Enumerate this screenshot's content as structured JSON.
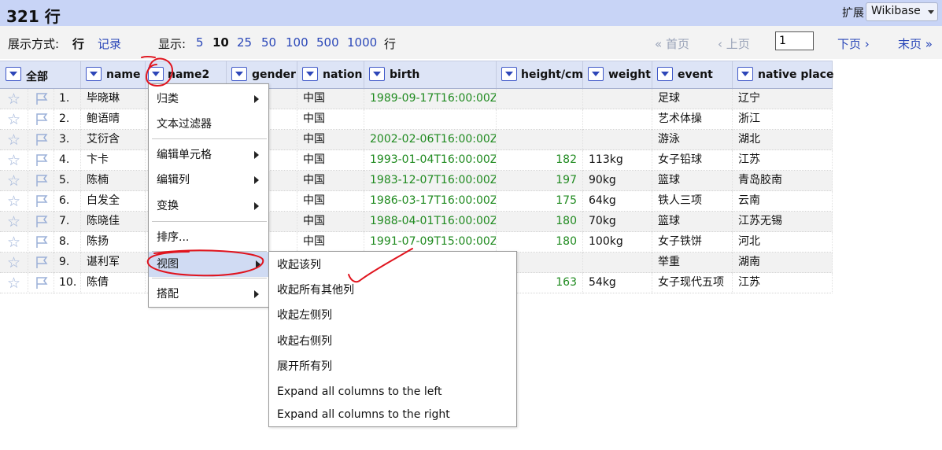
{
  "header": {
    "row_count": "321 行",
    "extensions_label": "扩展",
    "wikibase_label": "Wikibase"
  },
  "viewbar": {
    "show_as_label": "展示方式:",
    "mode_rows": "行",
    "mode_records": "记录",
    "display_label": "显示:",
    "page_sizes": [
      "5",
      "10",
      "25",
      "50",
      "100",
      "500",
      "1000"
    ],
    "rows_suffix": "行",
    "first": "« 首页",
    "prev": "‹ 上页",
    "page_value": "1",
    "next": "下页 ›",
    "last": "末页 »"
  },
  "columns": {
    "all": "全部",
    "name": "name",
    "name2": "name2",
    "gender": "gender",
    "nation": "nation",
    "birth": "birth",
    "height": "height/cm",
    "weight": "weight",
    "event": "event",
    "native_place": "native place"
  },
  "rows": [
    {
      "n": "1.",
      "name": "毕晓琳",
      "nation": "中国",
      "birth": "1989-09-17T16:00:00Z",
      "height": "",
      "weight": "",
      "event": "足球",
      "place": "辽宁"
    },
    {
      "n": "2.",
      "name": "鲍语晴",
      "nation": "中国",
      "birth": "",
      "height": "",
      "weight": "",
      "event": "艺术体操",
      "place": "浙江"
    },
    {
      "n": "3.",
      "name": "艾衍含",
      "nation": "中国",
      "birth": "2002-02-06T16:00:00Z",
      "height": "",
      "weight": "",
      "event": "游泳",
      "place": "湖北"
    },
    {
      "n": "4.",
      "name": "卞卡",
      "nation": "中国",
      "birth": "1993-01-04T16:00:00Z",
      "height": "182",
      "weight": "113kg",
      "event": "女子铅球",
      "place": "江苏"
    },
    {
      "n": "5.",
      "name": "陈楠",
      "nation": "中国",
      "birth": "1983-12-07T16:00:00Z",
      "height": "197",
      "weight": "90kg",
      "event": "篮球",
      "place": "青岛胶南"
    },
    {
      "n": "6.",
      "name": "白发全",
      "nation": "中国",
      "birth": "1986-03-17T16:00:00Z",
      "height": "175",
      "weight": "64kg",
      "event": "铁人三项",
      "place": "云南"
    },
    {
      "n": "7.",
      "name": "陈晓佳",
      "nation": "中国",
      "birth": "1988-04-01T16:00:00Z",
      "height": "180",
      "weight": "70kg",
      "event": "篮球",
      "place": "江苏无锡"
    },
    {
      "n": "8.",
      "name": "陈扬",
      "nation": "中国",
      "birth": "1991-07-09T15:00:00Z",
      "height": "180",
      "weight": "100kg",
      "event": "女子铁饼",
      "place": "河北"
    },
    {
      "n": "9.",
      "name": "谌利军",
      "nation": "",
      "birth": "",
      "height": "",
      "weight": "",
      "event": "举重",
      "place": "湖南"
    },
    {
      "n": "10.",
      "name": "陈倩",
      "nation": "",
      "birth": "",
      "height": "163",
      "weight": "54kg",
      "event": "女子现代五项",
      "place": "江苏"
    }
  ],
  "column_menu": {
    "facet": "归类",
    "text_filter": "文本过滤器",
    "edit_cells": "编辑单元格",
    "edit_column": "编辑列",
    "transform": "变换",
    "sort": "排序...",
    "view": "视图",
    "reconcile": "搭配"
  },
  "view_submenu": {
    "collapse_this": "收起该列",
    "collapse_others": "收起所有其他列",
    "collapse_left": "收起左侧列",
    "collapse_right": "收起右侧列",
    "expand_all": "展开所有列",
    "expand_left": "Expand all columns to the left",
    "expand_right": "Expand all columns to the right"
  },
  "colors": {
    "header_bg": "#c8d4f6",
    "link": "#2a47b8",
    "date_green": "#1f8a1f",
    "annotation_red": "#e0141e"
  },
  "icons": [
    "star-icon",
    "flag-icon",
    "dropdown-icon",
    "submenu-arrow-icon"
  ]
}
